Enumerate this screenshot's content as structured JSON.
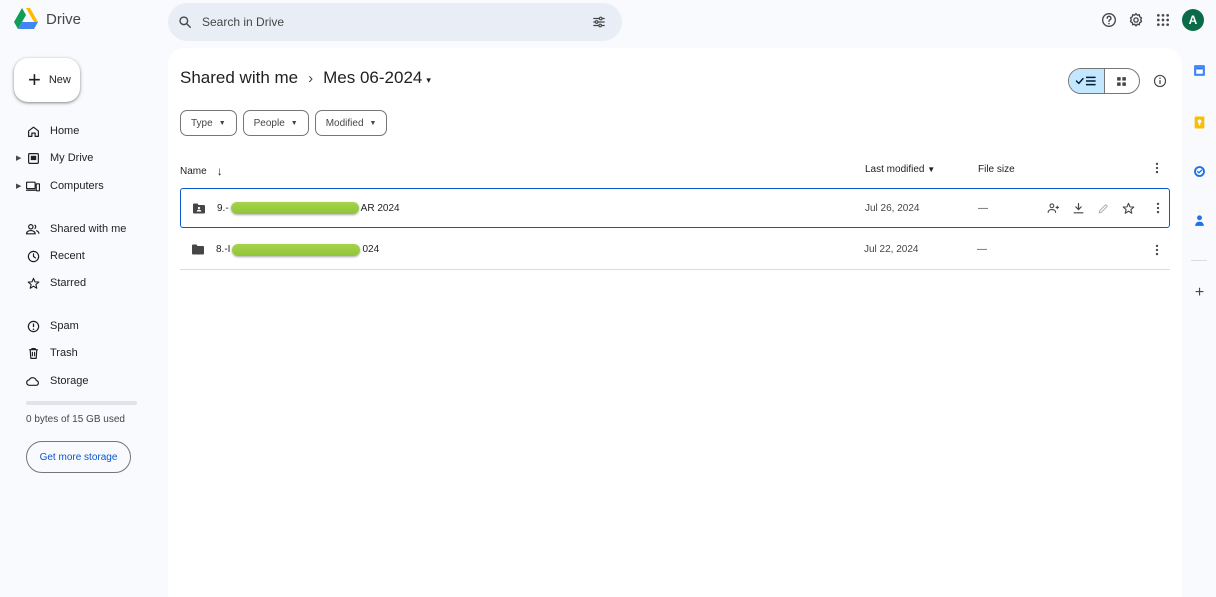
{
  "app": {
    "name": "Drive"
  },
  "search": {
    "placeholder": "Search in Drive"
  },
  "account": {
    "initial": "A",
    "color": "#0b6b49"
  },
  "sidebar": {
    "new_label": "New",
    "items": [
      {
        "label": "Home",
        "icon": "home-icon"
      },
      {
        "label": "My Drive",
        "icon": "my-drive-icon",
        "expandable": true
      },
      {
        "label": "Computers",
        "icon": "computers-icon",
        "expandable": true
      },
      {
        "label": "Shared with me",
        "icon": "shared-icon"
      },
      {
        "label": "Recent",
        "icon": "clock-icon"
      },
      {
        "label": "Starred",
        "icon": "star-icon"
      },
      {
        "label": "Spam",
        "icon": "spam-icon"
      },
      {
        "label": "Trash",
        "icon": "trash-icon"
      },
      {
        "label": "Storage",
        "icon": "cloud-icon"
      }
    ],
    "storage_used_fraction": 0,
    "storage_text": "0 bytes of 15 GB used",
    "storage_button": "Get more storage"
  },
  "breadcrumb": {
    "root": "Shared with me",
    "separator": "›",
    "current": "Mes 06-2024",
    "caret": "▾"
  },
  "view": {
    "active": "list"
  },
  "filters": [
    {
      "label": "Type"
    },
    {
      "label": "People"
    },
    {
      "label": "Modified"
    }
  ],
  "table": {
    "columns": {
      "name": "Name",
      "last_modified": "Last modified",
      "file_size": "File size"
    },
    "sort_arrow": "↓",
    "rows": [
      {
        "name_prefix": "9.-",
        "name_suffix": "AR 2024",
        "modified": "Jul 26, 2024",
        "size": "—",
        "selected": true,
        "shared_folder": true
      },
      {
        "name_prefix": "8.-I",
        "name_suffix": "024",
        "modified": "Jul 22, 2024",
        "size": "—",
        "selected": false,
        "shared_folder": false
      }
    ]
  },
  "side_panel": {
    "apps": [
      "calendar-icon",
      "keep-icon",
      "tasks-icon",
      "contacts-icon"
    ],
    "add_label": "+"
  },
  "colors": {
    "accent": "#0b57d0",
    "toggle_active": "#c2e7ff",
    "background": "#f8fafd",
    "redaction": "#9acd32"
  }
}
